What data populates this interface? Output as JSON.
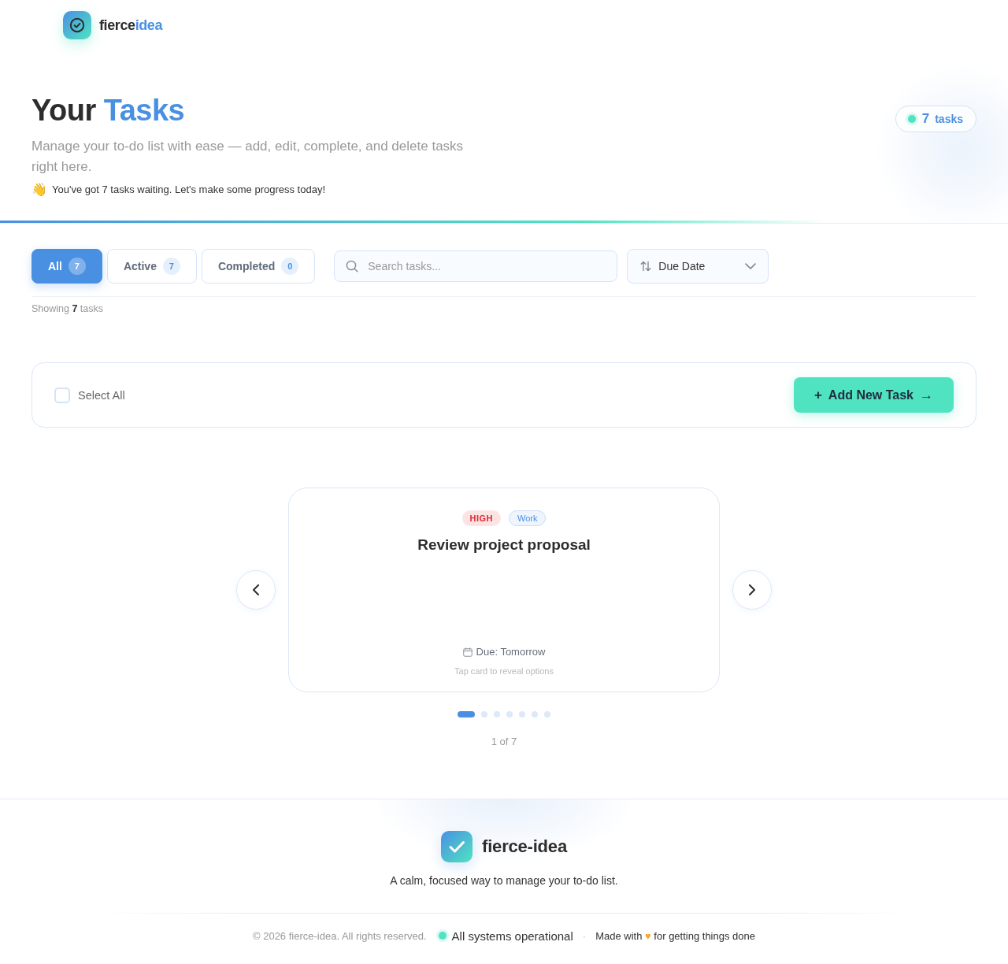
{
  "header": {
    "brand": {
      "first": "fierce",
      "second": "idea"
    }
  },
  "hero": {
    "title": {
      "first": "Your",
      "second": "Tasks"
    },
    "subtitle": "Manage your to-do list with ease — add, edit, complete, and delete tasks right here.",
    "greeting": {
      "emoji": "👋",
      "text": "You've got 7 tasks waiting. Let's make some progress today!"
    },
    "count_badge": {
      "count": "7",
      "label": "tasks"
    }
  },
  "filters": {
    "tabs": [
      {
        "label": "All",
        "count": "7",
        "selected": true
      },
      {
        "label": "Active",
        "count": "7",
        "selected": false
      },
      {
        "label": "Completed",
        "count": "0",
        "selected": false
      }
    ],
    "search": {
      "placeholder": "Search tasks..."
    },
    "sort": {
      "value": "Due Date"
    },
    "summary": "Showing **7** tasks"
  },
  "toolbar": {
    "select_all": {
      "label": "Select All",
      "checked": false
    },
    "add_button": {
      "leading": "+",
      "label": "Add New Task",
      "trailing": "→"
    }
  },
  "carousel": {
    "card": {
      "tags": [
        {
          "kind": "priority",
          "label": "HIGH"
        },
        {
          "kind": "category",
          "label": "Work"
        }
      ],
      "title": "Review project proposal",
      "due": "Due: Tomorrow",
      "hint": "Tap card to reveal options"
    },
    "dots": [
      {
        "selected": true
      },
      {
        "selected": false
      },
      {
        "selected": false
      },
      {
        "selected": false
      },
      {
        "selected": false
      },
      {
        "selected": false
      },
      {
        "selected": false
      }
    ],
    "counter": "1 of 7"
  },
  "footer": {
    "brand": "fierce-idea",
    "tagline": "A calm, focused way to manage your to-do list.",
    "copyright": "© 2026 fierce-idea. All rights reserved.",
    "status": "All systems operational",
    "separator": "·",
    "made_with": {
      "before": "Made with",
      "heart": "♥",
      "after": "for getting things done"
    }
  }
}
